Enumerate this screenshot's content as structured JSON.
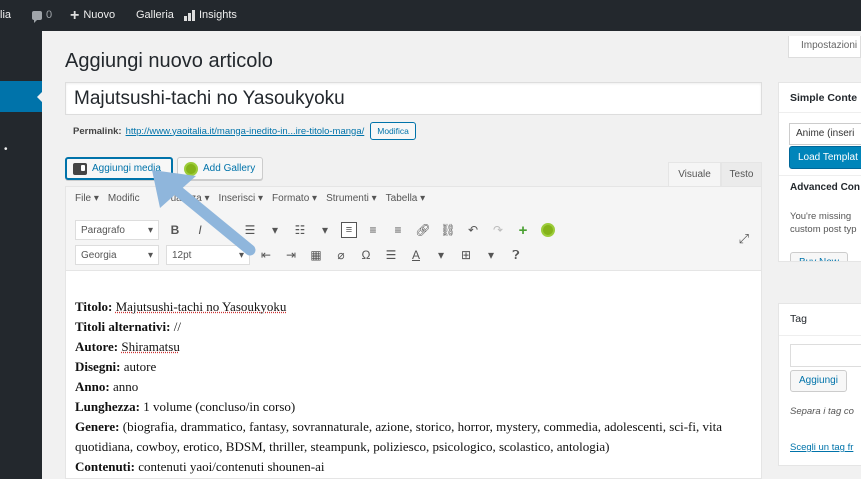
{
  "adminbar": {
    "site_fragment": "lia",
    "comments_count": "0",
    "new_label": "Nuovo",
    "gallery_label": "Galleria",
    "insights_label": "Insights"
  },
  "page_title": "Aggiungi nuovo articolo",
  "post_title": "Majutsushi-tachi no Yasoukyoku",
  "permalink": {
    "label": "Permalink:",
    "url": "http://www.yaoitalia.it/manga-inedito-in...ire-titolo-manga/",
    "edit_button": "Modifica"
  },
  "media_buttons": {
    "add_media": "Aggiungi media",
    "add_gallery": "Add Gallery"
  },
  "editor_tabs": {
    "visual": "Visuale",
    "text": "Testo"
  },
  "menubar": [
    "File ▾",
    "Modific",
    "ualizza ▾",
    "Inserisci ▾",
    "Formato ▾",
    "Strumenti ▾",
    "Tabella ▾"
  ],
  "toolbar": {
    "format_select": "Paragrafo",
    "font_select": "Georgia",
    "size_select": "12pt"
  },
  "content": {
    "lines": [
      {
        "label": "Titolo:",
        "value": "Majutsushi-tachi no Yasoukyoku"
      },
      {
        "label": "Titoli alternativi:",
        "value": "//"
      },
      {
        "label": "Autore:",
        "value": "Shiramatsu"
      },
      {
        "label": "Disegni:",
        "value": "autore"
      },
      {
        "label": "Anno:",
        "value": "anno"
      },
      {
        "label": "Lunghezza:",
        "value": "1 volume (concluso/in corso)"
      },
      {
        "label": "Genere:",
        "value": "(biografia, drammatico, fantasy, sovrannaturale, azione, storico, horror, mystery, commedia, adolescenti, sci-fi, vita quotidiana, cowboy, erotico, BDSM, thriller, steampunk, poliziesco, psicologico, scolastico, antologia)"
      },
      {
        "label": "Contenuti:",
        "value": "contenuti yaoi/contenuti shounen-ai"
      }
    ]
  },
  "sidebar": {
    "screen_options": "Impostazioni",
    "simple_content": {
      "title": "Simple Conte",
      "select_value": "Anime (inseri",
      "load_button": "Load Templat"
    },
    "advanced": {
      "title": "Advanced Con",
      "text1": "You're missing",
      "text2": "custom post typ",
      "buy_button": "Buy Now"
    },
    "tag": {
      "title": "Tag",
      "input_value": "",
      "add_button": "Aggiungi",
      "hint": "Separa i tag co",
      "choose_link": "Scegli un tag fr"
    }
  },
  "colors": {
    "adminbar": "#23282d",
    "accent": "#0073aa",
    "annotation_arrow": "#8fb6dc"
  }
}
